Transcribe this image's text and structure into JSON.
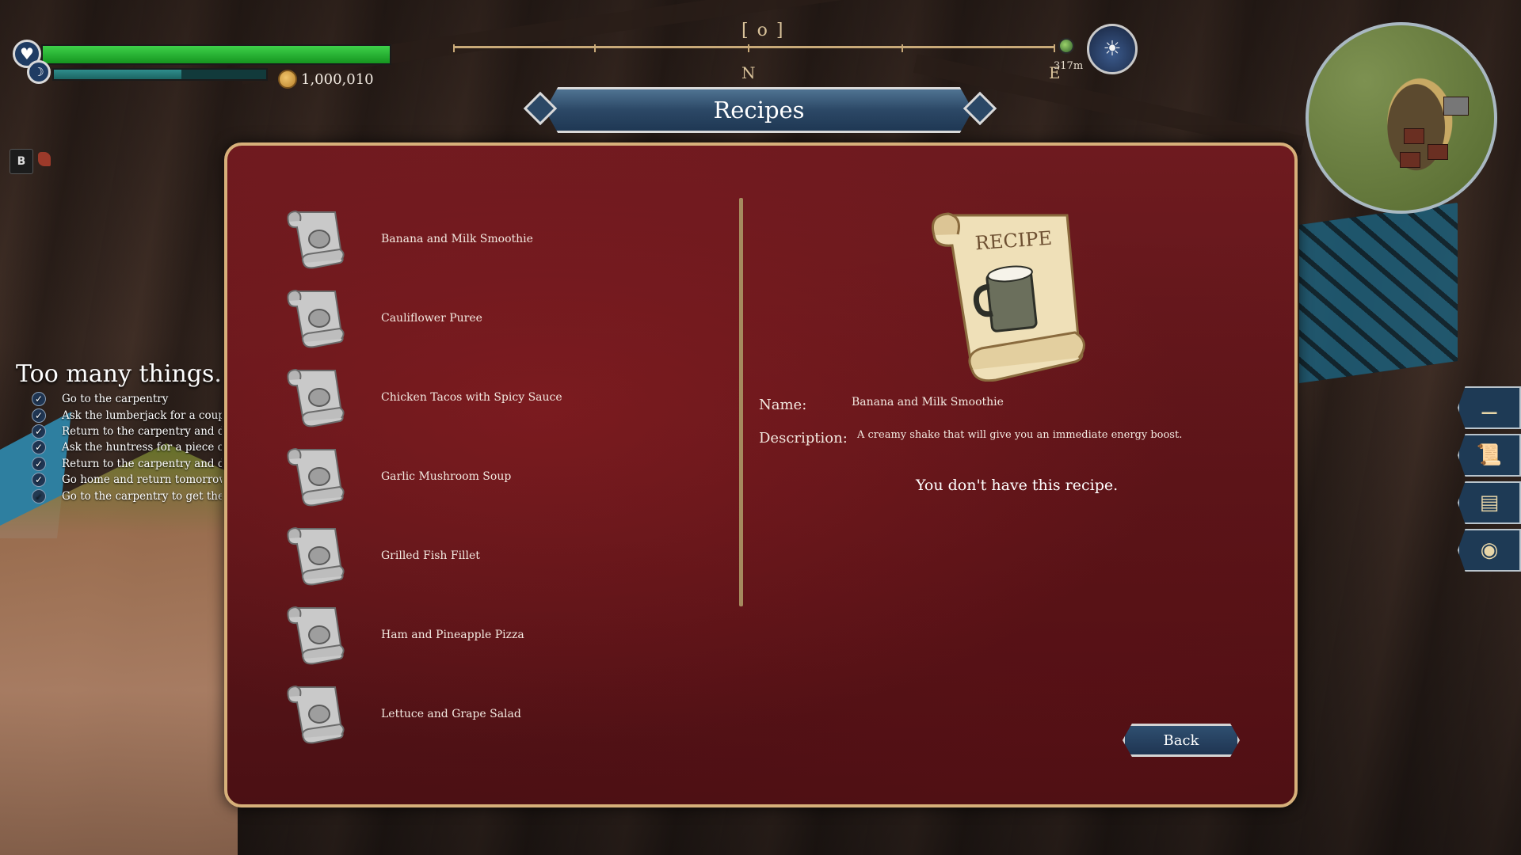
{
  "hud": {
    "hp_fraction": 1.0,
    "stamina_fraction": 0.6,
    "coins": "1,000,010",
    "key_hint": "B",
    "heart_icon": "heart-icon",
    "stamina_icon": "stomach-icon"
  },
  "compass": {
    "bracket": "[ o ]",
    "north": "N",
    "east": "E",
    "distance": "317m",
    "time_icon": "sunrise-icon"
  },
  "quest": {
    "title": "Too many things.",
    "items": [
      {
        "text": "Go to the carpentry",
        "done": true
      },
      {
        "text": "Ask the lumberjack for a couple of",
        "done": true
      },
      {
        "text": "Return to the carpentry and deliv",
        "done": true
      },
      {
        "text": "Ask the huntress for a piece of le",
        "done": true
      },
      {
        "text": "Return to the carpentry and deliv",
        "done": true
      },
      {
        "text": "Go home and return tomorrow.",
        "done": true
      },
      {
        "text": "Go to the carpentry to get the firs",
        "done": false
      }
    ]
  },
  "recipes_window": {
    "title": "Recipes",
    "list": [
      {
        "name": "Banana and Milk Smoothie",
        "icon": "mug-recipe-icon"
      },
      {
        "name": "Cauliflower Puree",
        "icon": "plate-recipe-icon"
      },
      {
        "name": "Chicken Tacos with Spicy Sauce",
        "icon": "taco-recipe-icon"
      },
      {
        "name": "Garlic Mushroom Soup",
        "icon": "bowl-recipe-icon"
      },
      {
        "name": "Grilled Fish Fillet",
        "icon": "fish-recipe-icon"
      },
      {
        "name": "Ham and Pineapple Pizza",
        "icon": "pizza-recipe-icon"
      },
      {
        "name": "Lettuce and Grape Salad",
        "icon": "salad-recipe-icon"
      }
    ],
    "detail": {
      "scroll_text": "RECIPE",
      "name_label": "Name:",
      "name_value": "Banana and Milk Smoothie",
      "description_label": "Description:",
      "description_value": "A creamy shake that will give you an immediate energy boost.",
      "status": "You don't have this recipe."
    },
    "back_label": "Back"
  },
  "hotbar": [
    {
      "icon": "log-icon"
    },
    {
      "icon": "scroll-icon"
    },
    {
      "icon": "parchment-icon"
    },
    {
      "icon": "fried-egg-icon"
    }
  ],
  "colors": {
    "panel": "#5e161b",
    "panel_border": "#d7b07a",
    "banner": "#2c4866",
    "hp": "#2bb53a",
    "stamina": "#2a7c7b"
  }
}
